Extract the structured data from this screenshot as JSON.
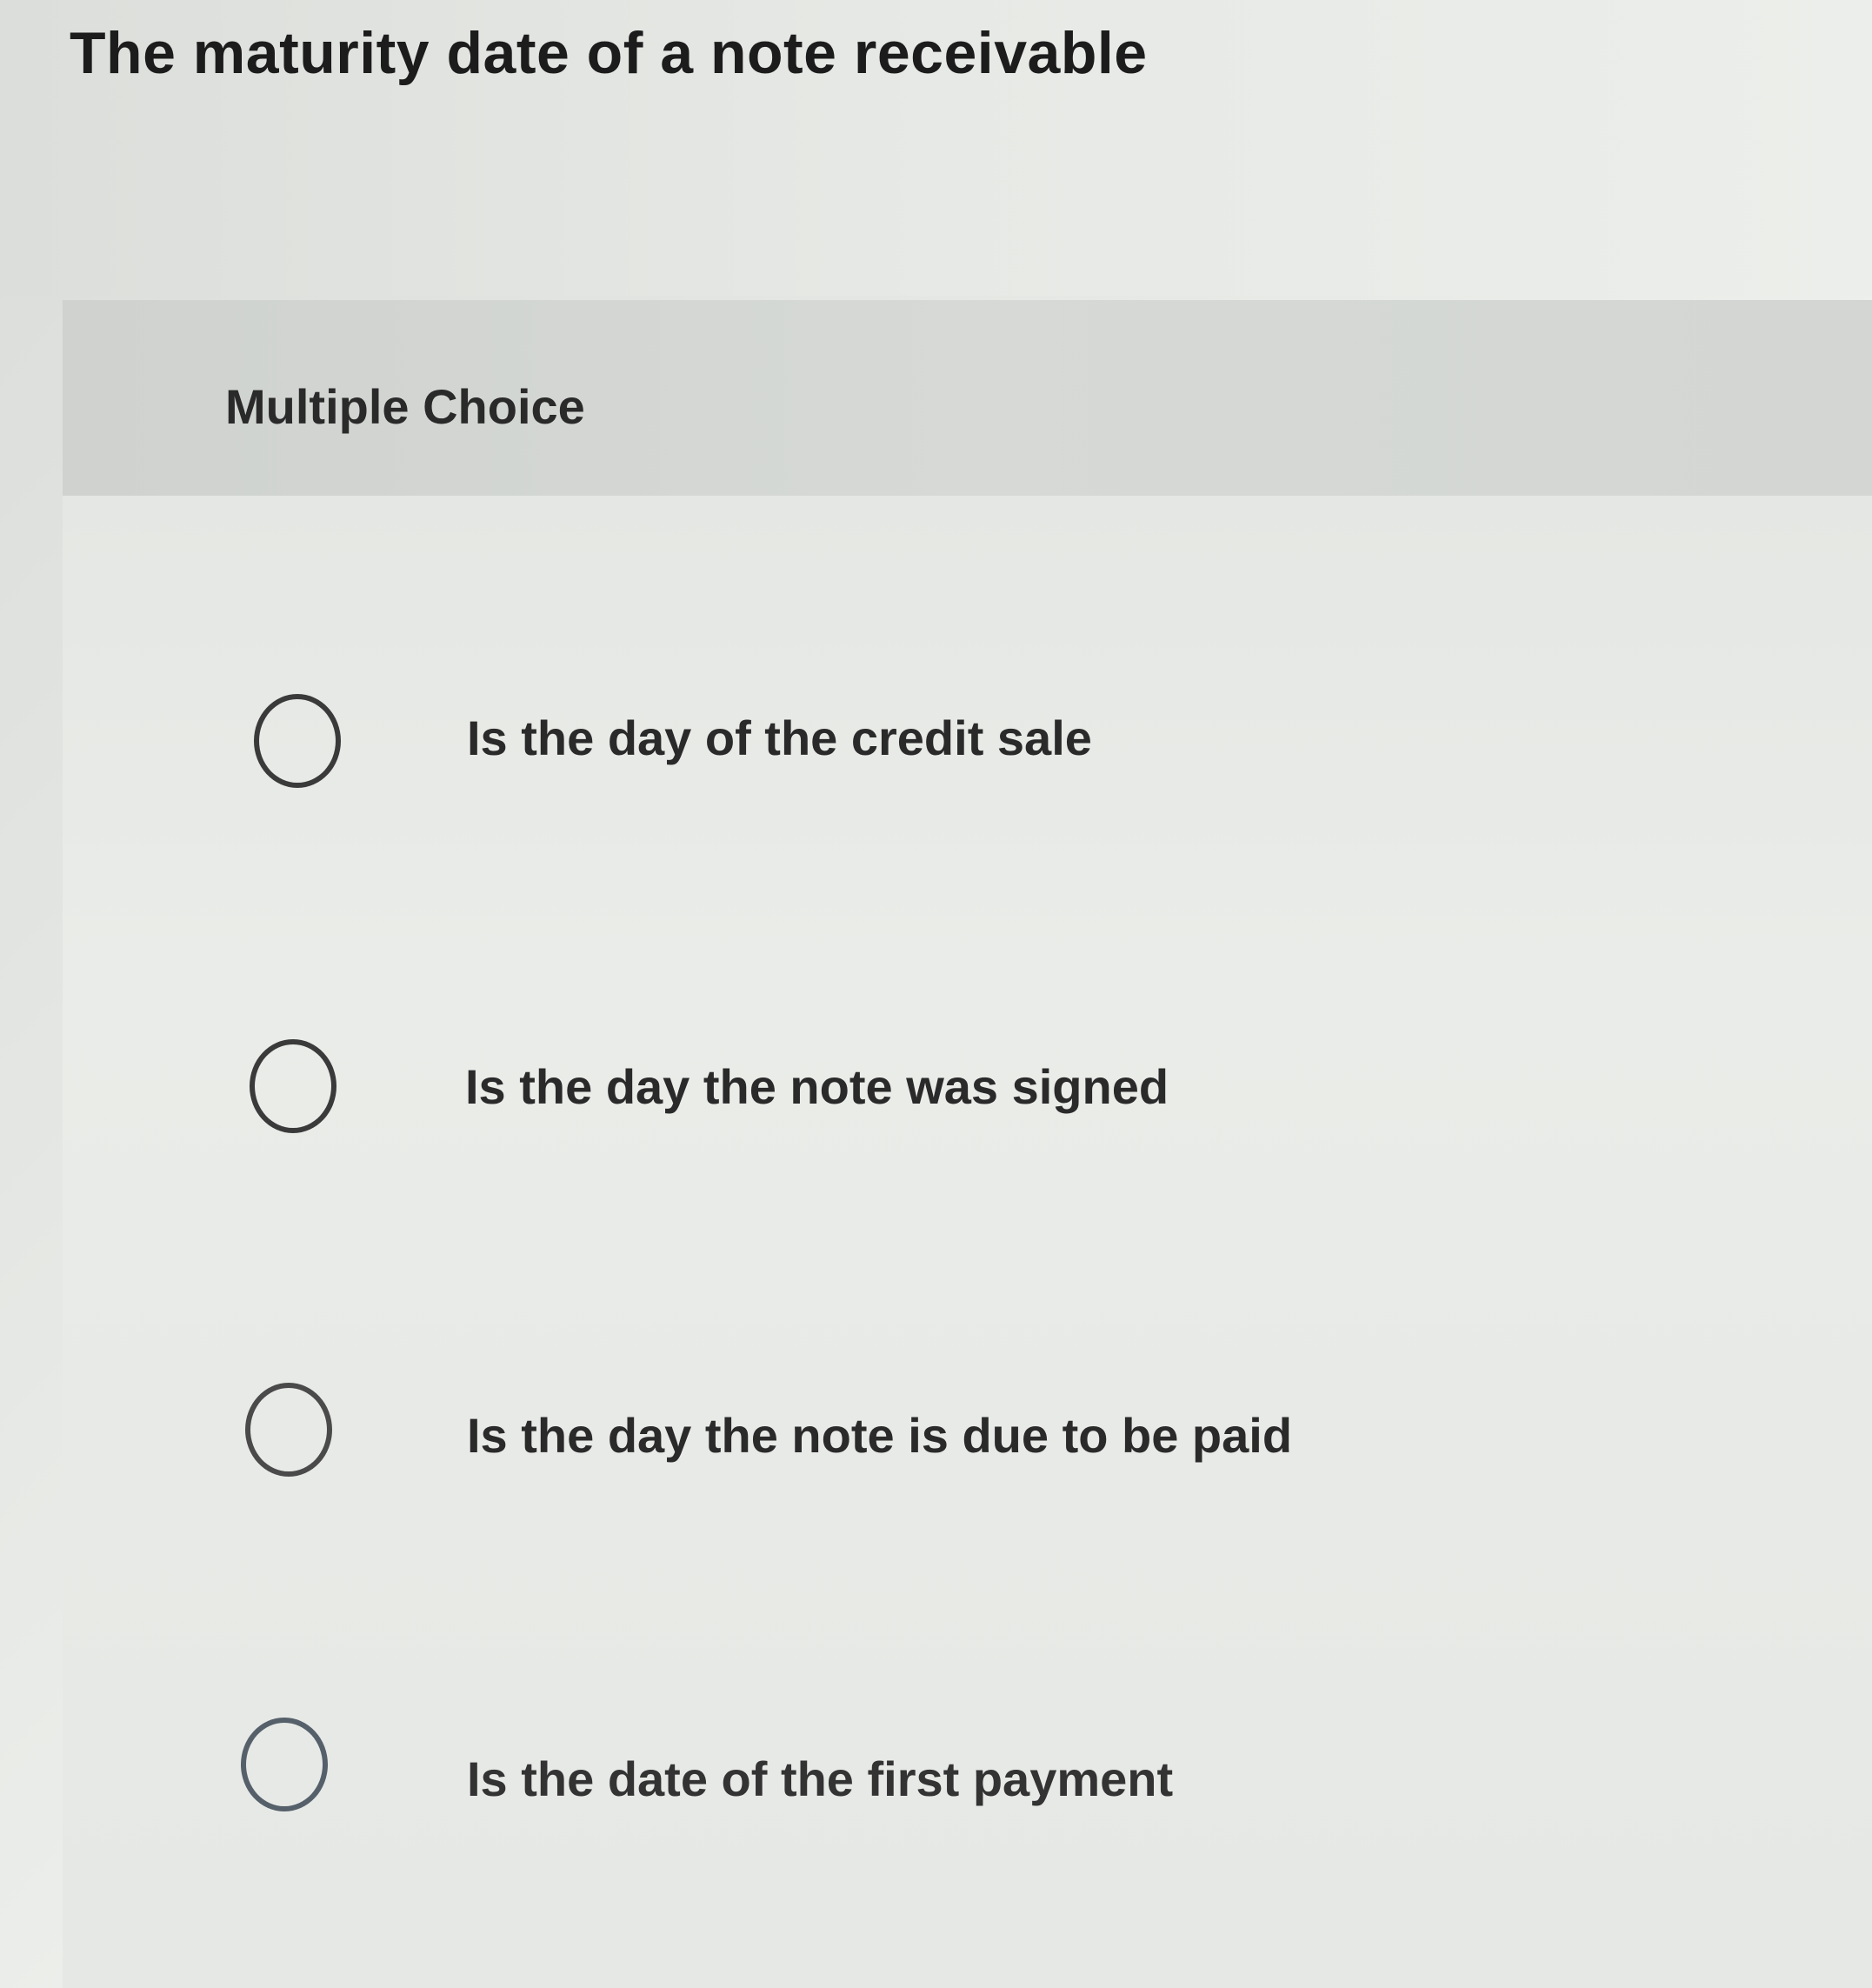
{
  "question": {
    "title": "The maturity date of a note receivable"
  },
  "choice_panel": {
    "header": "Multiple Choice",
    "options": [
      {
        "label": "Is the day of the credit sale",
        "selected": false
      },
      {
        "label": "Is the day the note was signed",
        "selected": false
      },
      {
        "label": "Is the day the note is due to be paid",
        "selected": false
      },
      {
        "label": "Is the date of the first payment",
        "selected": false
      }
    ]
  }
}
